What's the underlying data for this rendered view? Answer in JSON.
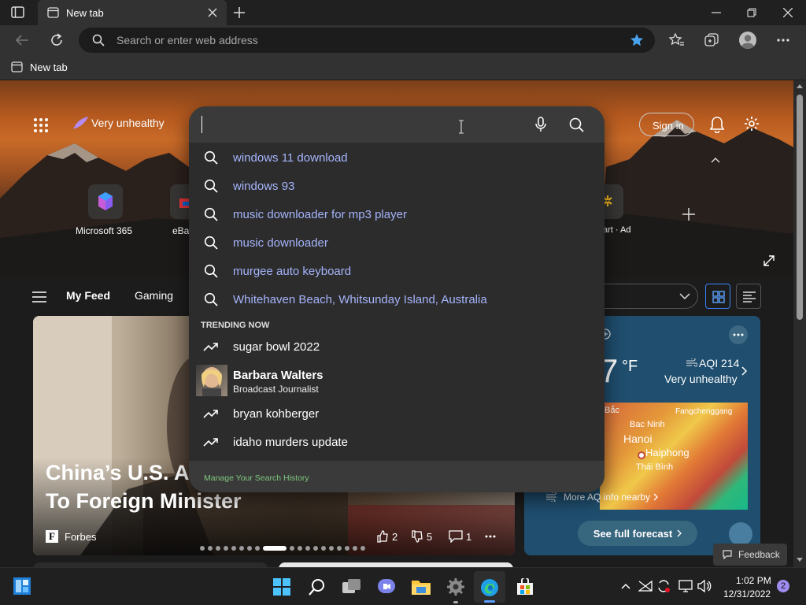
{
  "browser": {
    "tab_title": "New tab",
    "address_placeholder": "Search or enter web address",
    "favorites_item": "New tab"
  },
  "page": {
    "aqi_badge": "Very unhealthy",
    "sign_in": "Sign in",
    "quick_links": [
      "Microsoft 365",
      "eBay",
      "art · Ad"
    ],
    "feed_nav": {
      "my_feed": "My Feed",
      "gaming": "Gaming"
    },
    "news": {
      "headline_line1": "China’s U.S. Ar",
      "headline_line2": "To Foreign Minister",
      "source": "Forbes",
      "likes": "2",
      "dislikes": "5",
      "comments": "1"
    },
    "weather": {
      "temp": "7",
      "unit": "°F",
      "aqi": "AQI 214",
      "aqi_status": "Very unhealthy",
      "map_labels": [
        "Bắc",
        "Fangchenggang",
        "Bac Ninh",
        "Hanoi",
        "Haiphong",
        "Thái Bình"
      ],
      "more_aq": "More AQ info nearby",
      "forecast": "See full forecast"
    },
    "feedback": "Feedback"
  },
  "search": {
    "query": "",
    "suggestions": [
      "windows 11 download",
      "windows 93",
      "music downloader for mp3 player",
      "music downloader",
      "murgee auto keyboard",
      "Whitehaven Beach, Whitsunday Island, Australia"
    ],
    "trending_header": "TRENDING NOW",
    "trending": [
      {
        "title": "sugar bowl 2022"
      },
      {
        "title": "Barbara Walters",
        "subtitle": "Broadcast Journalist"
      },
      {
        "title": "bryan kohberger"
      },
      {
        "title": "idaho murders update"
      }
    ],
    "manage_history": "Manage Your Search History"
  },
  "taskbar": {
    "time": "1:02 PM",
    "date": "12/31/2022",
    "notification_count": "2"
  },
  "colors": {
    "suggestion_text": "#a5b4fc",
    "accent_blue": "#2b88d8",
    "manage_link": "#7fc77f"
  }
}
